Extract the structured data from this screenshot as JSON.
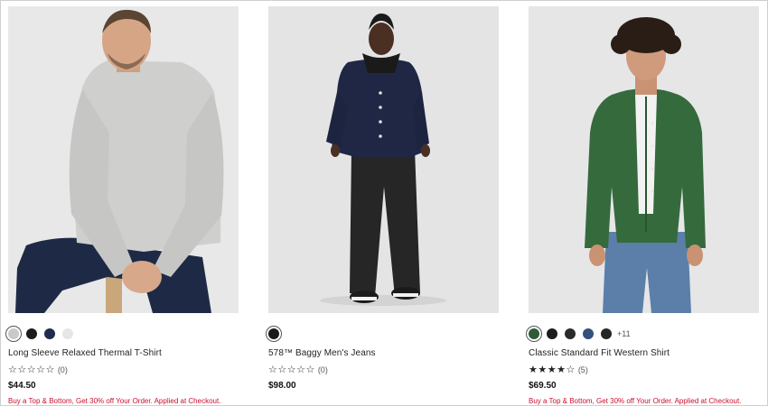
{
  "products": [
    {
      "name": "Long Sleeve Relaxed Thermal T-Shirt",
      "image_alt": "man in grey waffle-knit thermal shirt",
      "swatches": [
        {
          "color": "#c9c9c9",
          "selected": true
        },
        {
          "color": "#1c1c1c"
        },
        {
          "color": "#1f2c4d"
        },
        {
          "color": "#e6e6e6"
        }
      ],
      "more_colors": "",
      "rating": 0,
      "stars_text": "☆☆☆☆☆",
      "review_count": "(0)",
      "price": "$44.50",
      "promo": "Buy a Top & Bottom, Get 30% off Your Order. Applied at Checkout."
    },
    {
      "name": "578™ Baggy Men's Jeans",
      "image_alt": "man in dark denim jacket and black baggy jeans",
      "swatches": [
        {
          "color": "#1a1a1a",
          "selected": true
        }
      ],
      "more_colors": "",
      "rating": 0,
      "stars_text": "☆☆☆☆☆",
      "review_count": "(0)",
      "price": "$98.00",
      "promo": ""
    },
    {
      "name": "Classic Standard Fit Western Shirt",
      "image_alt": "man in green corduroy western shirt and blue jeans",
      "swatches": [
        {
          "color": "#2e5a38",
          "selected": true
        },
        {
          "color": "#1c1c1c"
        },
        {
          "color": "#2a2a2a"
        },
        {
          "color": "#33507e"
        },
        {
          "color": "#262626"
        }
      ],
      "more_colors": "+11",
      "rating": 4,
      "stars_text": "★★★★☆",
      "review_count": "(5)",
      "price": "$69.50",
      "promo": "Buy a Top & Bottom, Get 30% off Your Order. Applied at Checkout."
    }
  ],
  "colors": {
    "promo": "#c8102e",
    "image_background": "#e9e9ea"
  }
}
